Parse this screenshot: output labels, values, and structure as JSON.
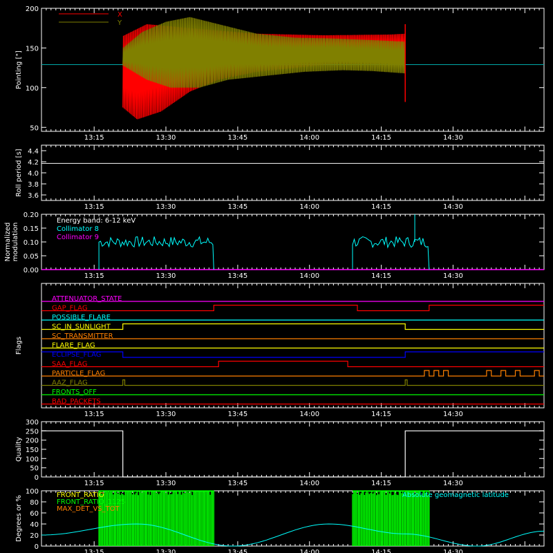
{
  "figure": {
    "background": "#000000",
    "axis_color": "#ffffff",
    "x_tick_labels": [
      "13:15",
      "13:30",
      "13:45",
      "14:00",
      "14:15",
      "14:30"
    ]
  },
  "chart_data": [
    {
      "type": "line",
      "ylabel": "Pointing [\"]",
      "ylim": [
        45,
        200
      ],
      "yticks": [
        50,
        100,
        150,
        200
      ],
      "xlim": [
        "13:04",
        "14:49"
      ],
      "baseline": 129,
      "series": [
        {
          "name": "X",
          "color": "#ff0000",
          "data_start": "13:21",
          "data_end": "14:20",
          "upper": [
            [
              0,
              165
            ],
            [
              5,
              180
            ],
            [
              14,
              175
            ],
            [
              28,
              168
            ],
            [
              42,
              166
            ],
            [
              56,
              167
            ],
            [
              59,
              168
            ]
          ],
          "lower": [
            [
              0,
              75
            ],
            [
              3,
              60
            ],
            [
              8,
              70
            ],
            [
              14,
              95
            ],
            [
              20,
              110
            ],
            [
              28,
              120
            ],
            [
              36,
              125
            ],
            [
              44,
              130
            ],
            [
              52,
              130
            ],
            [
              59,
              130
            ]
          ]
        },
        {
          "name": "Y",
          "color": "#808000",
          "data_start": "13:21",
          "data_end": "14:20",
          "upper": [
            [
              0,
              150
            ],
            [
              4,
              170
            ],
            [
              9,
              183
            ],
            [
              14,
              189
            ],
            [
              20,
              180
            ],
            [
              28,
              168
            ],
            [
              36,
              163
            ],
            [
              44,
              162
            ],
            [
              52,
              160
            ],
            [
              59,
              158
            ]
          ],
          "lower": [
            [
              0,
              128
            ],
            [
              5,
              110
            ],
            [
              10,
              100
            ],
            [
              16,
              100
            ],
            [
              22,
              110
            ],
            [
              30,
              115
            ],
            [
              38,
              120
            ],
            [
              46,
              122
            ],
            [
              52,
              121
            ],
            [
              59,
              118
            ]
          ]
        }
      ]
    },
    {
      "type": "line",
      "ylabel": "Roll period [s]",
      "ylim": [
        3.5,
        4.5
      ],
      "yticks": [
        3.6,
        3.8,
        4.0,
        4.2,
        4.4
      ],
      "value": 4.17
    },
    {
      "type": "line",
      "ylabel": "Normalized\nmodulation",
      "ylim": [
        0,
        0.2
      ],
      "yticks": [
        0.0,
        0.05,
        0.1,
        0.15,
        0.2
      ],
      "annotation": "Energy band: 6-12 keV",
      "series": [
        {
          "name": "Collimator 8",
          "color": "#00ffff",
          "segments": [
            [
              "13:16",
              "13:40",
              0.1
            ],
            [
              "14:09",
              "14:25",
              0.1
            ]
          ],
          "peak": [
            "14:22",
            0.2
          ]
        },
        {
          "name": "Collimator 9",
          "color": "#ff00ff",
          "value": 0
        }
      ]
    },
    {
      "type": "line",
      "ylabel": "Flags",
      "series": [
        {
          "name": "ATTENUATOR_STATE",
          "color": "#ff00ff",
          "steps": []
        },
        {
          "name": "GAP_FLAG",
          "color": "#ff0000",
          "steps": [
            [
              "13:40",
              1
            ],
            [
              "14:10",
              0
            ],
            [
              "14:25",
              1
            ]
          ]
        },
        {
          "name": "POSSIBLE_FLARE",
          "color": "#00ffff",
          "steps": []
        },
        {
          "name": "SC_IN_SUNLIGHT",
          "color": "#ffff00",
          "steps": [
            [
              "13:21",
              1
            ],
            [
              "14:20",
              0
            ]
          ]
        },
        {
          "name": "SC_TRANSMITTER",
          "color": "#ff8000",
          "steps": []
        },
        {
          "name": "FLARE_FLAG",
          "color": "#ffff00",
          "steps": []
        },
        {
          "name": "ECLIPSE_FLAG",
          "color": "#0000ff",
          "steps": [
            [
              "13:21",
              0
            ],
            [
              "14:20",
              1
            ]
          ],
          "initial": 1
        },
        {
          "name": "SAA_FLAG",
          "color": "#ff0000",
          "steps": [
            [
              "13:41",
              1
            ],
            [
              "14:08",
              0
            ]
          ]
        },
        {
          "name": "PARTICLE_FLAG",
          "color": "#ff8000",
          "pulses": [
            [
              "14:24",
              "14:25"
            ],
            [
              "14:26",
              "14:27"
            ],
            [
              "14:28",
              "14:29"
            ],
            [
              "14:37",
              "14:38"
            ],
            [
              "14:40",
              "14:41"
            ],
            [
              "14:43",
              "14:44"
            ],
            [
              "14:47",
              "14:48"
            ]
          ]
        },
        {
          "name": "AAZ_FLAG",
          "color": "#808000",
          "pulses": [
            [
              "13:21",
              "13:21.4"
            ],
            [
              "14:20",
              "14:20.4"
            ]
          ]
        },
        {
          "name": "FRONTS_OFF",
          "color": "#00ff00",
          "steps": []
        },
        {
          "name": "BAD_PACKETS",
          "color": "#ff0000",
          "steps": []
        }
      ]
    },
    {
      "type": "line",
      "ylabel": "Quality",
      "ylim": [
        0,
        300
      ],
      "yticks": [
        0,
        50,
        100,
        150,
        200,
        250,
        300
      ],
      "segments": [
        [
          "13:04",
          "13:21",
          250
        ],
        [
          "13:21",
          "14:20",
          0
        ],
        [
          "14:20",
          "14:49",
          250
        ]
      ]
    },
    {
      "type": "line",
      "ylabel": "Degrees or %",
      "ylim": [
        0,
        100
      ],
      "yticks": [
        0,
        20,
        40,
        60,
        80,
        100
      ],
      "series": [
        {
          "name": "FRONT_RATIO",
          "color": "#ffff00"
        },
        {
          "name": "FRONT_RATIO_1125",
          "color": "#00ff00",
          "bands": [
            [
              "13:16",
              "13:40"
            ],
            [
              "14:09",
              "14:25"
            ]
          ]
        },
        {
          "name": "MAX_DET_VS_TOT",
          "color": "#ff8000"
        },
        {
          "name": "Absolute geomagnetic latitude",
          "color": "#00ffff",
          "curve": [
            [
              "13:04",
              20
            ],
            [
              "13:24",
              40
            ],
            [
              "13:44",
              0
            ],
            [
              "14:04",
              40
            ],
            [
              "14:20",
              22
            ],
            [
              "14:35",
              0
            ],
            [
              "14:49",
              27
            ]
          ]
        }
      ]
    }
  ]
}
